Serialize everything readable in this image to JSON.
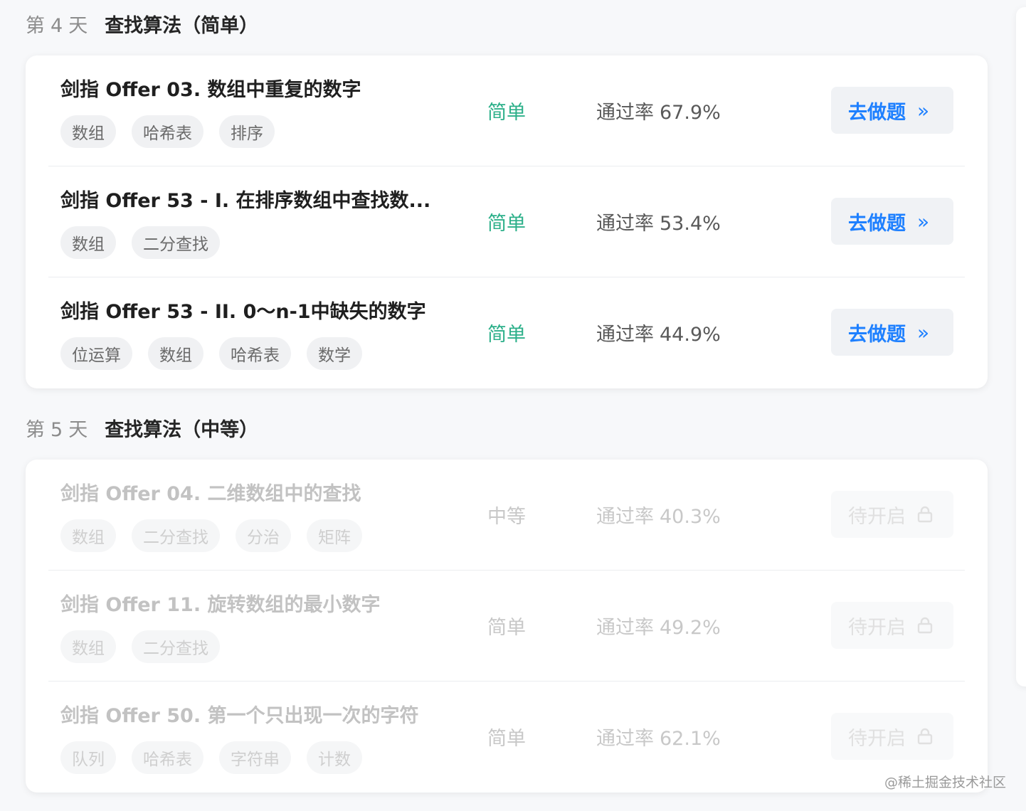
{
  "sections": [
    {
      "day_prefix": "第",
      "day_number": "4",
      "day_suffix": "天",
      "title": "查找算法（简单）",
      "locked": false,
      "problems": [
        {
          "title": "剑指 Offer 03. 数组中重复的数字",
          "tags": [
            "数组",
            "哈希表",
            "排序"
          ],
          "difficulty": "简单",
          "pass_label": "通过率",
          "pass_rate": "67.9%",
          "action": "去做题"
        },
        {
          "title": "剑指 Offer 53 - I. 在排序数组中查找数...",
          "tags": [
            "数组",
            "二分查找"
          ],
          "difficulty": "简单",
          "pass_label": "通过率",
          "pass_rate": "53.4%",
          "action": "去做题"
        },
        {
          "title": "剑指 Offer 53 - II. 0～n-1中缺失的数字",
          "tags": [
            "位运算",
            "数组",
            "哈希表",
            "数学"
          ],
          "difficulty": "简单",
          "pass_label": "通过率",
          "pass_rate": "44.9%",
          "action": "去做题"
        }
      ]
    },
    {
      "day_prefix": "第",
      "day_number": "5",
      "day_suffix": "天",
      "title": "查找算法（中等）",
      "locked": true,
      "problems": [
        {
          "title": "剑指 Offer 04. 二维数组中的查找",
          "tags": [
            "数组",
            "二分查找",
            "分治",
            "矩阵"
          ],
          "difficulty": "中等",
          "pass_label": "通过率",
          "pass_rate": "40.3%",
          "action": "待开启"
        },
        {
          "title": "剑指 Offer 11. 旋转数组的最小数字",
          "tags": [
            "数组",
            "二分查找"
          ],
          "difficulty": "简单",
          "pass_label": "通过率",
          "pass_rate": "49.2%",
          "action": "待开启"
        },
        {
          "title": "剑指 Offer 50. 第一个只出现一次的字符",
          "tags": [
            "队列",
            "哈希表",
            "字符串",
            "计数"
          ],
          "difficulty": "简单",
          "pass_label": "通过率",
          "pass_rate": "62.1%",
          "action": "待开启"
        }
      ]
    }
  ],
  "action_icon_open": "chevron-double-right-icon",
  "action_icon_locked": "lock-icon",
  "colors": {
    "accent_blue": "#1e80ff",
    "easy_green": "#2db08a"
  },
  "watermark": "@稀土掘金技术社区"
}
